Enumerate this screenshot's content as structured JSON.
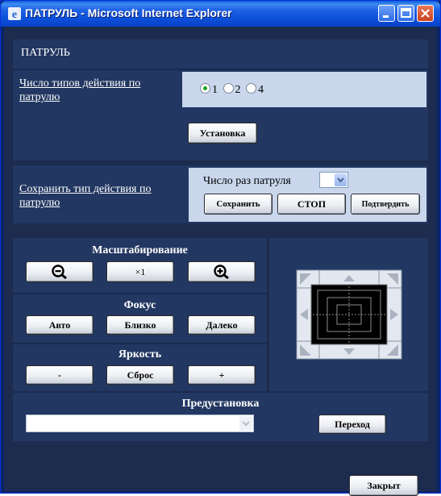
{
  "window": {
    "title": "ПАТРУЛЬ - Microsoft Internet Explorer"
  },
  "header": {
    "title": "ПАТРУЛЬ"
  },
  "patrol_types": {
    "label": "Число типов действия по патрулю",
    "options": [
      "1",
      "2",
      "4"
    ],
    "selected": "1",
    "set_button": "Установка"
  },
  "save_patrol": {
    "label": "Сохранить тип действия по патрулю",
    "count_label": "Число раз патруля",
    "count_value": "",
    "save_button": "Сохранить",
    "stop_button": "СТОП",
    "confirm_button": "Подтвердить"
  },
  "zoom": {
    "title": "Масштабирование",
    "wide_icon": "zoom-out-icon",
    "x1_label": "×1",
    "tele_icon": "zoom-in-icon"
  },
  "focus": {
    "title": "Фокус",
    "auto": "Авто",
    "near": "Близко",
    "far": "Далеко"
  },
  "brightness": {
    "title": "Яркость",
    "minus": "-",
    "reset": "Сброс",
    "plus": "+"
  },
  "preset": {
    "title": "Предустановка",
    "value": "",
    "go_button": "Переход"
  },
  "close_button": "Закрыт",
  "colors": {
    "background": "#1C2B4E",
    "panel": "#223761",
    "light_panel": "#C9D6EC",
    "titlebar": "#0B4FD8"
  }
}
